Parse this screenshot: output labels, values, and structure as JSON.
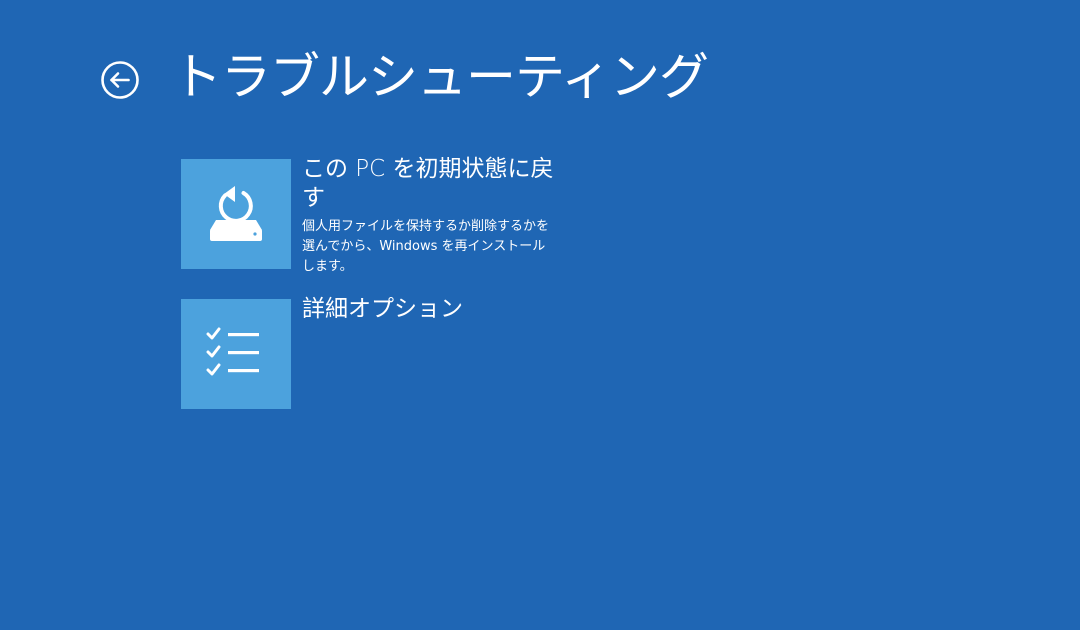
{
  "header": {
    "title": "トラブルシューティング",
    "back_icon": "back-arrow-circle-icon"
  },
  "options": [
    {
      "title": "この PC を初期状態に戻す",
      "description": "個人用ファイルを保持するか削除するかを選んでから、Windows を再インストールします。",
      "icon": "reset-pc-icon"
    },
    {
      "title": "詳細オプション",
      "description": "",
      "icon": "checklist-icon"
    }
  ],
  "colors": {
    "background": "#1f66b4",
    "tile": "#4ca2dd",
    "text": "#ffffff"
  }
}
